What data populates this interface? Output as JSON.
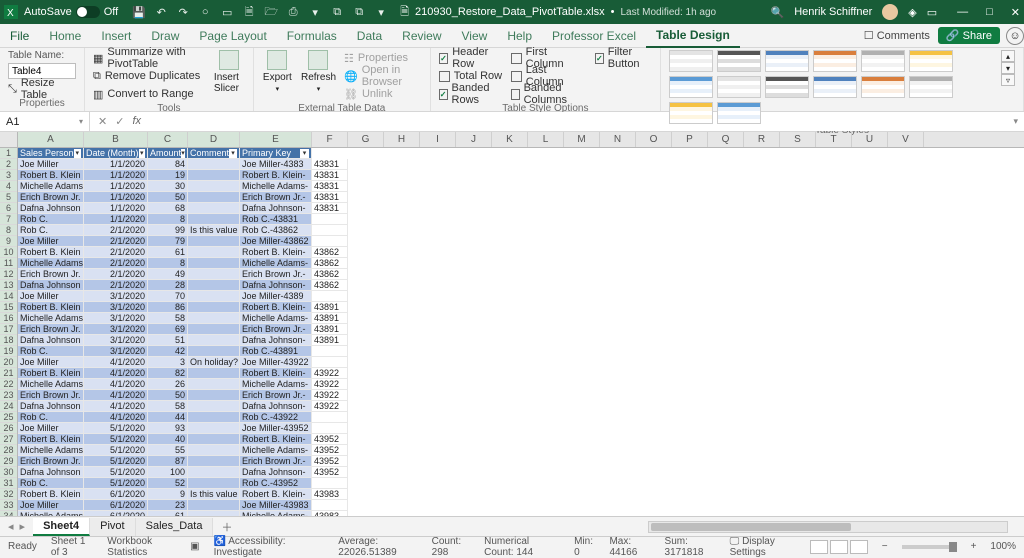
{
  "titlebar": {
    "autosave_label": "AutoSave",
    "autosave_state": "Off",
    "filename": "210930_Restore_Data_PivotTable.xlsx",
    "modified": "Last Modified: 1h ago",
    "username": "Henrik Schiffner"
  },
  "ribbon_tabs": [
    "File",
    "Home",
    "Insert",
    "Draw",
    "Page Layout",
    "Formulas",
    "Data",
    "Review",
    "View",
    "Help",
    "Professor Excel",
    "Table Design"
  ],
  "ribbon_right": {
    "comments": "Comments",
    "share": "Share"
  },
  "groups": {
    "properties": {
      "title": "Properties",
      "table_name_label": "Table Name:",
      "table_name_value": "Table4",
      "resize": "Resize Table"
    },
    "tools": {
      "title": "Tools",
      "summarize": "Summarize with PivotTable",
      "remove_dupes": "Remove Duplicates",
      "convert": "Convert to Range",
      "slicer": "Insert Slicer"
    },
    "external": {
      "title": "External Table Data",
      "export": "Export",
      "refresh": "Refresh",
      "props": "Properties",
      "browser": "Open in Browser",
      "unlink": "Unlink"
    },
    "style_options": {
      "title": "Table Style Options",
      "header_row": "Header Row",
      "total_row": "Total Row",
      "banded_rows": "Banded Rows",
      "first_col": "First Column",
      "last_col": "Last Column",
      "banded_cols": "Banded Columns",
      "filter_btn": "Filter Button"
    },
    "styles": {
      "title": "Table Styles"
    }
  },
  "formula_bar": {
    "name_box": "A1",
    "formula": ""
  },
  "columns": {
    "letters": [
      "A",
      "B",
      "C",
      "D",
      "E",
      "F",
      "G",
      "H",
      "I",
      "J",
      "K",
      "L",
      "M",
      "N",
      "O",
      "P",
      "Q",
      "R",
      "S",
      "T",
      "U",
      "V"
    ],
    "widths": [
      66,
      64,
      40,
      52,
      72,
      36,
      36,
      36,
      36,
      36,
      36,
      36,
      36,
      36,
      36,
      36,
      36,
      36,
      36,
      36,
      36,
      36
    ]
  },
  "table": {
    "headers": [
      "Sales Person",
      "Date (Month)",
      "Amount",
      "Comment",
      "Primary Key"
    ],
    "rows": [
      {
        "sp": "Joe Miller",
        "dt": "1/1/2020",
        "amt": 84,
        "cm": "",
        "pk": "Joe Miller-4383",
        "ov": "43831"
      },
      {
        "sp": "Robert B. Klein",
        "dt": "1/1/2020",
        "amt": 19,
        "cm": "",
        "pk": "Robert B. Klein-",
        "ov": "43831"
      },
      {
        "sp": "Michelle Adams",
        "dt": "1/1/2020",
        "amt": 30,
        "cm": "",
        "pk": "Michelle Adams-",
        "ov": "43831"
      },
      {
        "sp": "Erich Brown Jr.",
        "dt": "1/1/2020",
        "amt": 50,
        "cm": "",
        "pk": "Erich Brown Jr.-",
        "ov": "43831"
      },
      {
        "sp": "Dafna Johnson",
        "dt": "1/1/2020",
        "amt": 68,
        "cm": "",
        "pk": "Dafna Johnson-",
        "ov": "43831"
      },
      {
        "sp": "Rob C.",
        "dt": "1/1/2020",
        "amt": 8,
        "cm": "",
        "pk": "Rob C.-43831",
        "ov": ""
      },
      {
        "sp": "Rob C.",
        "dt": "2/1/2020",
        "amt": 99,
        "cm": "Is this value c",
        "pk": "Rob C.-43862",
        "ov": ""
      },
      {
        "sp": "Joe Miller",
        "dt": "2/1/2020",
        "amt": 79,
        "cm": "",
        "pk": "Joe Miller-43862",
        "ov": ""
      },
      {
        "sp": "Robert B. Klein",
        "dt": "2/1/2020",
        "amt": 61,
        "cm": "",
        "pk": "Robert B. Klein-",
        "ov": "43862"
      },
      {
        "sp": "Michelle Adams",
        "dt": "2/1/2020",
        "amt": 8,
        "cm": "",
        "pk": "Michelle Adams-",
        "ov": "43862"
      },
      {
        "sp": "Erich Brown Jr.",
        "dt": "2/1/2020",
        "amt": 49,
        "cm": "",
        "pk": "Erich Brown Jr.-",
        "ov": "43862"
      },
      {
        "sp": "Dafna Johnson",
        "dt": "2/1/2020",
        "amt": 28,
        "cm": "",
        "pk": "Dafna Johnson-",
        "ov": "43862"
      },
      {
        "sp": "Joe Miller",
        "dt": "3/1/2020",
        "amt": 70,
        "cm": "",
        "pk": "Joe Miller-4389",
        "ov": ""
      },
      {
        "sp": "Robert B. Klein",
        "dt": "3/1/2020",
        "amt": 86,
        "cm": "",
        "pk": "Robert B. Klein-",
        "ov": "43891"
      },
      {
        "sp": "Michelle Adams",
        "dt": "3/1/2020",
        "amt": 58,
        "cm": "",
        "pk": "Michelle Adams-",
        "ov": "43891"
      },
      {
        "sp": "Erich Brown Jr.",
        "dt": "3/1/2020",
        "amt": 69,
        "cm": "",
        "pk": "Erich Brown Jr.-",
        "ov": "43891"
      },
      {
        "sp": "Dafna Johnson",
        "dt": "3/1/2020",
        "amt": 51,
        "cm": "",
        "pk": "Dafna Johnson-",
        "ov": "43891"
      },
      {
        "sp": "Rob C.",
        "dt": "3/1/2020",
        "amt": 42,
        "cm": "",
        "pk": "Rob C.-43891",
        "ov": ""
      },
      {
        "sp": "Joe Miller",
        "dt": "4/1/2020",
        "amt": 3,
        "cm": "On holiday?",
        "pk": "Joe Miller-43922",
        "ov": ""
      },
      {
        "sp": "Robert B. Klein",
        "dt": "4/1/2020",
        "amt": 82,
        "cm": "",
        "pk": "Robert B. Klein-",
        "ov": "43922"
      },
      {
        "sp": "Michelle Adams",
        "dt": "4/1/2020",
        "amt": 26,
        "cm": "",
        "pk": "Michelle Adams-",
        "ov": "43922"
      },
      {
        "sp": "Erich Brown Jr.",
        "dt": "4/1/2020",
        "amt": 50,
        "cm": "",
        "pk": "Erich Brown Jr.-",
        "ov": "43922"
      },
      {
        "sp": "Dafna Johnson",
        "dt": "4/1/2020",
        "amt": 58,
        "cm": "",
        "pk": "Dafna Johnson-",
        "ov": "43922"
      },
      {
        "sp": "Rob C.",
        "dt": "4/1/2020",
        "amt": 44,
        "cm": "",
        "pk": "Rob C.-43922",
        "ov": ""
      },
      {
        "sp": "Joe Miller",
        "dt": "5/1/2020",
        "amt": 93,
        "cm": "",
        "pk": "Joe Miller-43952",
        "ov": ""
      },
      {
        "sp": "Robert B. Klein",
        "dt": "5/1/2020",
        "amt": 40,
        "cm": "",
        "pk": "Robert B. Klein-",
        "ov": "43952"
      },
      {
        "sp": "Michelle Adams",
        "dt": "5/1/2020",
        "amt": 55,
        "cm": "",
        "pk": "Michelle Adams-",
        "ov": "43952"
      },
      {
        "sp": "Erich Brown Jr.",
        "dt": "5/1/2020",
        "amt": 87,
        "cm": "",
        "pk": "Erich Brown Jr.-",
        "ov": "43952"
      },
      {
        "sp": "Dafna Johnson",
        "dt": "5/1/2020",
        "amt": 100,
        "cm": "",
        "pk": "Dafna Johnson-",
        "ov": "43952"
      },
      {
        "sp": "Rob C.",
        "dt": "5/1/2020",
        "amt": 52,
        "cm": "",
        "pk": "Rob C.-43952",
        "ov": ""
      },
      {
        "sp": "Robert B. Klein",
        "dt": "6/1/2020",
        "amt": 9,
        "cm": "Is this value c",
        "pk": "Robert B. Klein-",
        "ov": "43983"
      },
      {
        "sp": "Joe Miller",
        "dt": "6/1/2020",
        "amt": 23,
        "cm": "",
        "pk": "Joe Miller-43983",
        "ov": ""
      },
      {
        "sp": "Michelle Adams",
        "dt": "6/1/2020",
        "amt": 61,
        "cm": "",
        "pk": "Michelle Adams-",
        "ov": "43983"
      }
    ]
  },
  "sheets": {
    "tabs": [
      "Sheet4",
      "Pivot",
      "Sales_Data"
    ],
    "active": 0
  },
  "status": {
    "ready": "Ready",
    "sheet_info": "Sheet 1 of 3",
    "wb_stats": "Workbook Statistics",
    "accessibility": "Accessibility: Investigate",
    "average": "Average: 22026.51389",
    "count": "Count: 298",
    "num_count": "Numerical Count: 144",
    "min": "Min: 0",
    "max": "Max: 44166",
    "sum": "Sum: 3171818",
    "display": "Display Settings",
    "zoom": "100%"
  }
}
